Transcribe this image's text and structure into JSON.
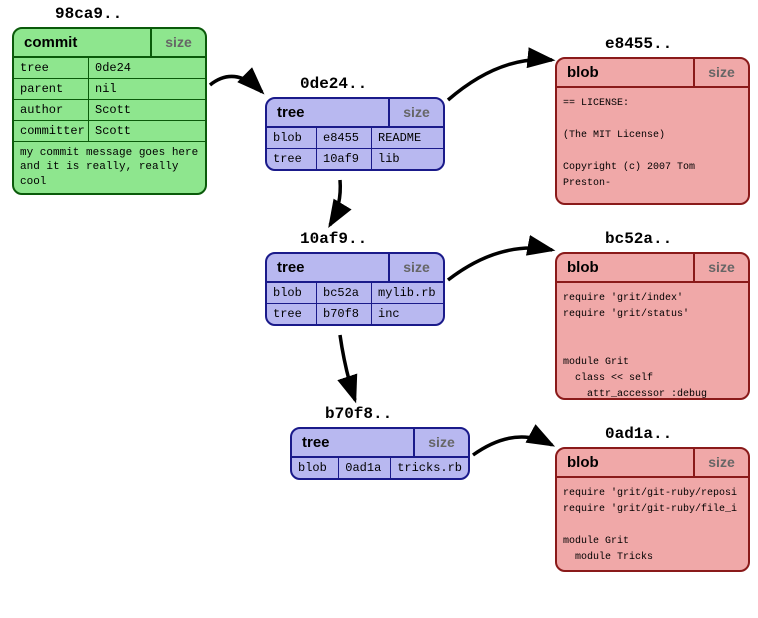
{
  "commit": {
    "hash": "98ca9..",
    "type_label": "commit",
    "size_label": "size",
    "rows": [
      {
        "key": "tree",
        "value": "0de24"
      },
      {
        "key": "parent",
        "value": "nil"
      },
      {
        "key": "author",
        "value": "Scott"
      },
      {
        "key": "committer",
        "value": "Scott"
      }
    ],
    "message": "my commit message goes here and it is really, really cool"
  },
  "trees": [
    {
      "hash": "0de24..",
      "type_label": "tree",
      "size_label": "size",
      "entries": [
        {
          "type": "blob",
          "hash": "e8455",
          "name": "README"
        },
        {
          "type": "tree",
          "hash": "10af9",
          "name": "lib"
        }
      ]
    },
    {
      "hash": "10af9..",
      "type_label": "tree",
      "size_label": "size",
      "entries": [
        {
          "type": "blob",
          "hash": "bc52a",
          "name": "mylib.rb"
        },
        {
          "type": "tree",
          "hash": "b70f8",
          "name": "inc"
        }
      ]
    },
    {
      "hash": "b70f8..",
      "type_label": "tree",
      "size_label": "size",
      "entries": [
        {
          "type": "blob",
          "hash": "0ad1a",
          "name": "tricks.rb"
        }
      ]
    }
  ],
  "blobs": [
    {
      "hash": "e8455..",
      "type_label": "blob",
      "size_label": "size",
      "content": "== LICENSE:\n\n(The MIT License)\n\nCopyright (c) 2007 Tom Preston-\n\nPermission is hereby granted, free of charge, to any person ob"
    },
    {
      "hash": "bc52a..",
      "type_label": "blob",
      "size_label": "size",
      "content": "require 'grit/index'\nrequire 'grit/status'\n\n\nmodule Grit\n  class << self\n    attr_accessor :debug"
    },
    {
      "hash": "0ad1a..",
      "type_label": "blob",
      "size_label": "size",
      "content": "require 'grit/git-ruby/reposi\nrequire 'grit/git-ruby/file_i\n\nmodule Grit\n  module Tricks"
    }
  ]
}
